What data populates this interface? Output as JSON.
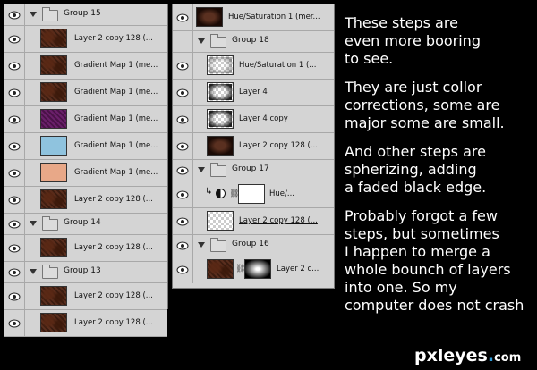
{
  "left_panel": {
    "rows": [
      {
        "type": "group",
        "name": "Group 15",
        "thumb": ""
      },
      {
        "type": "layer",
        "name": "Layer 2 copy 128 (...",
        "thumb": "tex"
      },
      {
        "type": "layer",
        "name": "Gradient Map 1 (me...",
        "thumb": "tex"
      },
      {
        "type": "layer",
        "name": "Gradient Map 1 (me...",
        "thumb": "tex"
      },
      {
        "type": "layer",
        "name": "Gradient Map 1 (me...",
        "thumb": "purple"
      },
      {
        "type": "layer",
        "name": "Gradient Map 1 (me...",
        "thumb": "blue"
      },
      {
        "type": "layer",
        "name": "Gradient Map 1 (me...",
        "thumb": "peach"
      },
      {
        "type": "layer",
        "name": "Layer 2 copy 128 (...",
        "thumb": "tex"
      },
      {
        "type": "group",
        "name": "Group 14",
        "thumb": ""
      },
      {
        "type": "layer",
        "name": "Layer 2 copy 128 (...",
        "thumb": "tex"
      },
      {
        "type": "group",
        "name": "Group 13",
        "thumb": ""
      },
      {
        "type": "layer",
        "name": "Layer 2 copy 128 (...",
        "thumb": "tex"
      },
      {
        "type": "layer",
        "name": "Layer 2 copy 128 (...",
        "thumb": "tex"
      }
    ]
  },
  "mid_panel": {
    "top_layer": {
      "name": "Hue/Saturation 1 (mer..."
    },
    "group18": {
      "name": "Group 18"
    },
    "g18_layers": [
      {
        "name": "Hue/Saturation 1 (..."
      },
      {
        "name": "Layer 4"
      },
      {
        "name": "Layer 4 copy"
      },
      {
        "name": "Layer 2 copy 128 (..."
      }
    ],
    "group17": {
      "name": "Group 17"
    },
    "g17_adj": {
      "name": "Hue/..."
    },
    "g17_layer": {
      "name": "Layer 2 copy 128 (..."
    },
    "group16": {
      "name": "Group 16"
    },
    "g16_layer": {
      "name": "Layer 2 c..."
    }
  },
  "notes": {
    "p1": "These steps are\neven more booring\nto see.",
    "p2": "They are just collor\ncorrections, some are\nmajor some are small.",
    "p3": "And other steps are\nspherizing, adding\na faded black edge.",
    "p4": "Probably forgot a few\nsteps, but sometimes\nI happen to merge a\nwhole bounch of layers\ninto one. So my\ncomputer does not crash"
  },
  "watermark": {
    "part1": "pxleyes",
    "dot": ".",
    "part2": "com"
  },
  "icons": {
    "visibility": "eye-icon",
    "folder": "folder-icon",
    "expand": "triangle-down-icon",
    "link": "chain-link-icon"
  }
}
